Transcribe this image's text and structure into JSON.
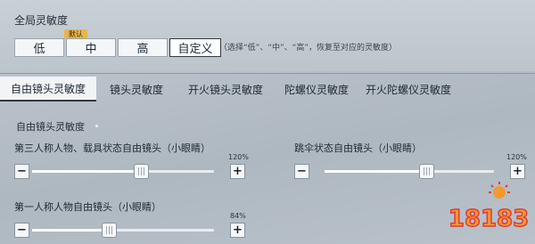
{
  "global": {
    "title": "全局灵敏度",
    "options": [
      "低",
      "中",
      "高",
      "自定义"
    ],
    "selected": "自定义",
    "default_badge": "默认",
    "hint": "（选择“低”、“中”、“高”，恢复至对应的灵敏度）"
  },
  "tabs": [
    "自由镜头灵敏度",
    "镜头灵敏度",
    "开火镜头灵敏度",
    "陀螺仪灵敏度",
    "开火陀螺仪灵敏度"
  ],
  "active_tab": "自由镜头灵敏度",
  "section": {
    "title": "自由镜头灵敏度"
  },
  "sliders": [
    {
      "label": "第三人称人物、载具状态自由镜头（小眼睛）",
      "value_text": "120%",
      "value": 120
    },
    {
      "label": "跳伞状态自由镜头（小眼睛）",
      "value_text": "120%",
      "value": 120
    },
    {
      "label": "第一人称人物自由镜头（小眼睛）",
      "value_text": "84%",
      "value": 84
    }
  ],
  "stepper": {
    "minus": "−",
    "plus": "+"
  },
  "watermark": {
    "text": "18183"
  },
  "colors": {
    "accent": "#e8b54c",
    "logo_red": "#e23a3a",
    "logo_orange": "#f29a2e"
  }
}
